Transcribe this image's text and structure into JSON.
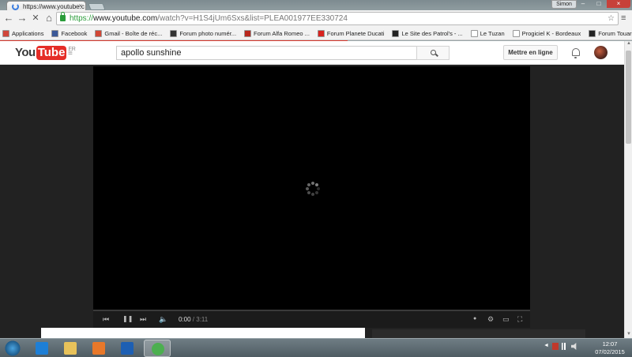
{
  "browser": {
    "tab_title": "https://www.youtube.c",
    "tab_close": "×",
    "profile_name": "Simon",
    "window_controls": {
      "minimize": "–",
      "maximize": "□",
      "close": "×"
    },
    "nav": {
      "back": "←",
      "forward": "→",
      "stop": "✕",
      "home": "⌂"
    },
    "url_scheme": "https://",
    "url_host": "www.youtube.com",
    "url_rest": "/watch?v=H1S4jUm6Sxs&list=PLEA001977EE330724",
    "omnibox_icons": "☆",
    "menu_icon": "≡",
    "bookmarks": [
      {
        "label": "Applications",
        "color": "#d0463b"
      },
      {
        "label": "Facebook",
        "color": "#3b5998"
      },
      {
        "label": "Gmail - Boîte de réc...",
        "color": "#d14836"
      },
      {
        "label": "Forum photo numér...",
        "color": "#333333"
      },
      {
        "label": "Forum Alfa Romeo ...",
        "color": "#b8281e"
      },
      {
        "label": "Forum Planete Ducati",
        "color": "#d8231f"
      },
      {
        "label": "Le Site des Patrol's - ...",
        "color": "#222222"
      },
      {
        "label": "Le Tuzan",
        "color": "#ffffff"
      },
      {
        "label": "Progiciel K - Bordeaux",
        "color": "#ffffff"
      },
      {
        "label": "Forum Touareg",
        "color": "#222222"
      }
    ],
    "page_progress": 0.55
  },
  "youtube": {
    "logo_you": "You",
    "logo_tube": "Tube",
    "logo_region": "FR",
    "guide_icon": "≡",
    "search_value": "apollo sunshine",
    "upload_label": "Mettre en ligne",
    "player": {
      "current_time": "0:00",
      "duration": "3:11",
      "separator": " / ",
      "controls": {
        "prev": "⏮",
        "pause": "❚❚",
        "next": "⏭",
        "volume": "🔈",
        "info": "●",
        "settings": "⚙",
        "theater": "▭",
        "fullscreen": "⛶"
      }
    }
  },
  "taskbar": {
    "apps": [
      {
        "name": "internet-explorer",
        "color": "#1e7fd6"
      },
      {
        "name": "file-explorer",
        "color": "#e8c25a"
      },
      {
        "name": "media-player",
        "color": "#e8782a"
      },
      {
        "name": "outlook",
        "color": "#1d5fb3"
      },
      {
        "name": "chrome",
        "color": "#4caf50"
      }
    ],
    "tray_text": "◄",
    "time": "12:07",
    "date": "07/02/2015"
  }
}
